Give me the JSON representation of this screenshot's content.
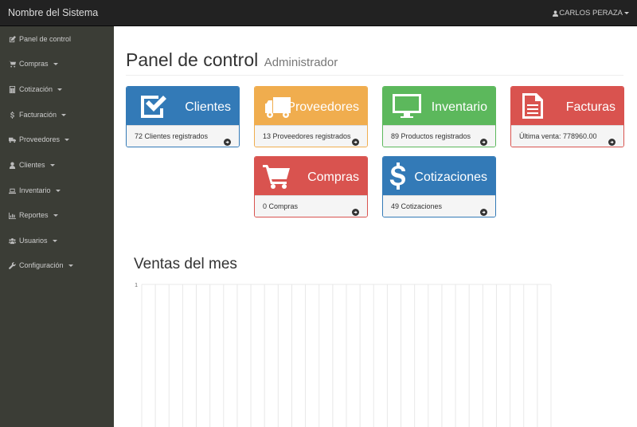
{
  "navbar": {
    "brand": "Nombre del Sistema",
    "user": "CARLOS PERAZA"
  },
  "sidebar": {
    "items": [
      {
        "label": "Panel de control",
        "icon": "edit-icon",
        "has_caret": false
      },
      {
        "label": "Compras",
        "icon": "cart-icon",
        "has_caret": true
      },
      {
        "label": "Cotización",
        "icon": "calculator-icon",
        "has_caret": true
      },
      {
        "label": "Facturación",
        "icon": "dollar-icon",
        "has_caret": true
      },
      {
        "label": "Proveedores",
        "icon": "truck-icon",
        "has_caret": true
      },
      {
        "label": "Clientes",
        "icon": "user-icon",
        "has_caret": true
      },
      {
        "label": "Inventario",
        "icon": "laptop-icon",
        "has_caret": true
      },
      {
        "label": "Reportes",
        "icon": "bar-chart-icon",
        "has_caret": true
      },
      {
        "label": "Usuarios",
        "icon": "users-icon",
        "has_caret": true
      },
      {
        "label": "Configuración",
        "icon": "wrench-icon",
        "has_caret": true
      }
    ]
  },
  "header": {
    "title": "Panel de control",
    "subtitle": "Administrador"
  },
  "panels": [
    {
      "title": "Clientes",
      "footer": "72 Clientes registrados",
      "color": "#337ab7",
      "icon": "check-square-icon"
    },
    {
      "title": "Proveedores",
      "footer": "13 Proveedores registrados",
      "color": "#f0ad4e",
      "icon": "truck-icon"
    },
    {
      "title": "Inventario",
      "footer": "89 Productos registrados",
      "color": "#5cb85c",
      "icon": "desktop-icon"
    },
    {
      "title": "Facturas",
      "footer": "Última venta: 778960.00",
      "color": "#d9534f",
      "icon": "file-text-icon"
    },
    {
      "title": "Compras",
      "footer": "0 Compras",
      "color": "#d9534f",
      "icon": "cart-icon"
    },
    {
      "title": "Cotizaciones",
      "footer": "49 Cotizaciones",
      "color": "#337ab7",
      "icon": "dollar-icon"
    }
  ],
  "chart_section": {
    "title": "Ventas del mes"
  },
  "chart_data": {
    "type": "line",
    "title": "",
    "xlabel": "",
    "ylabel": "",
    "y_ticks": [
      "1"
    ],
    "grid": true,
    "series": []
  }
}
